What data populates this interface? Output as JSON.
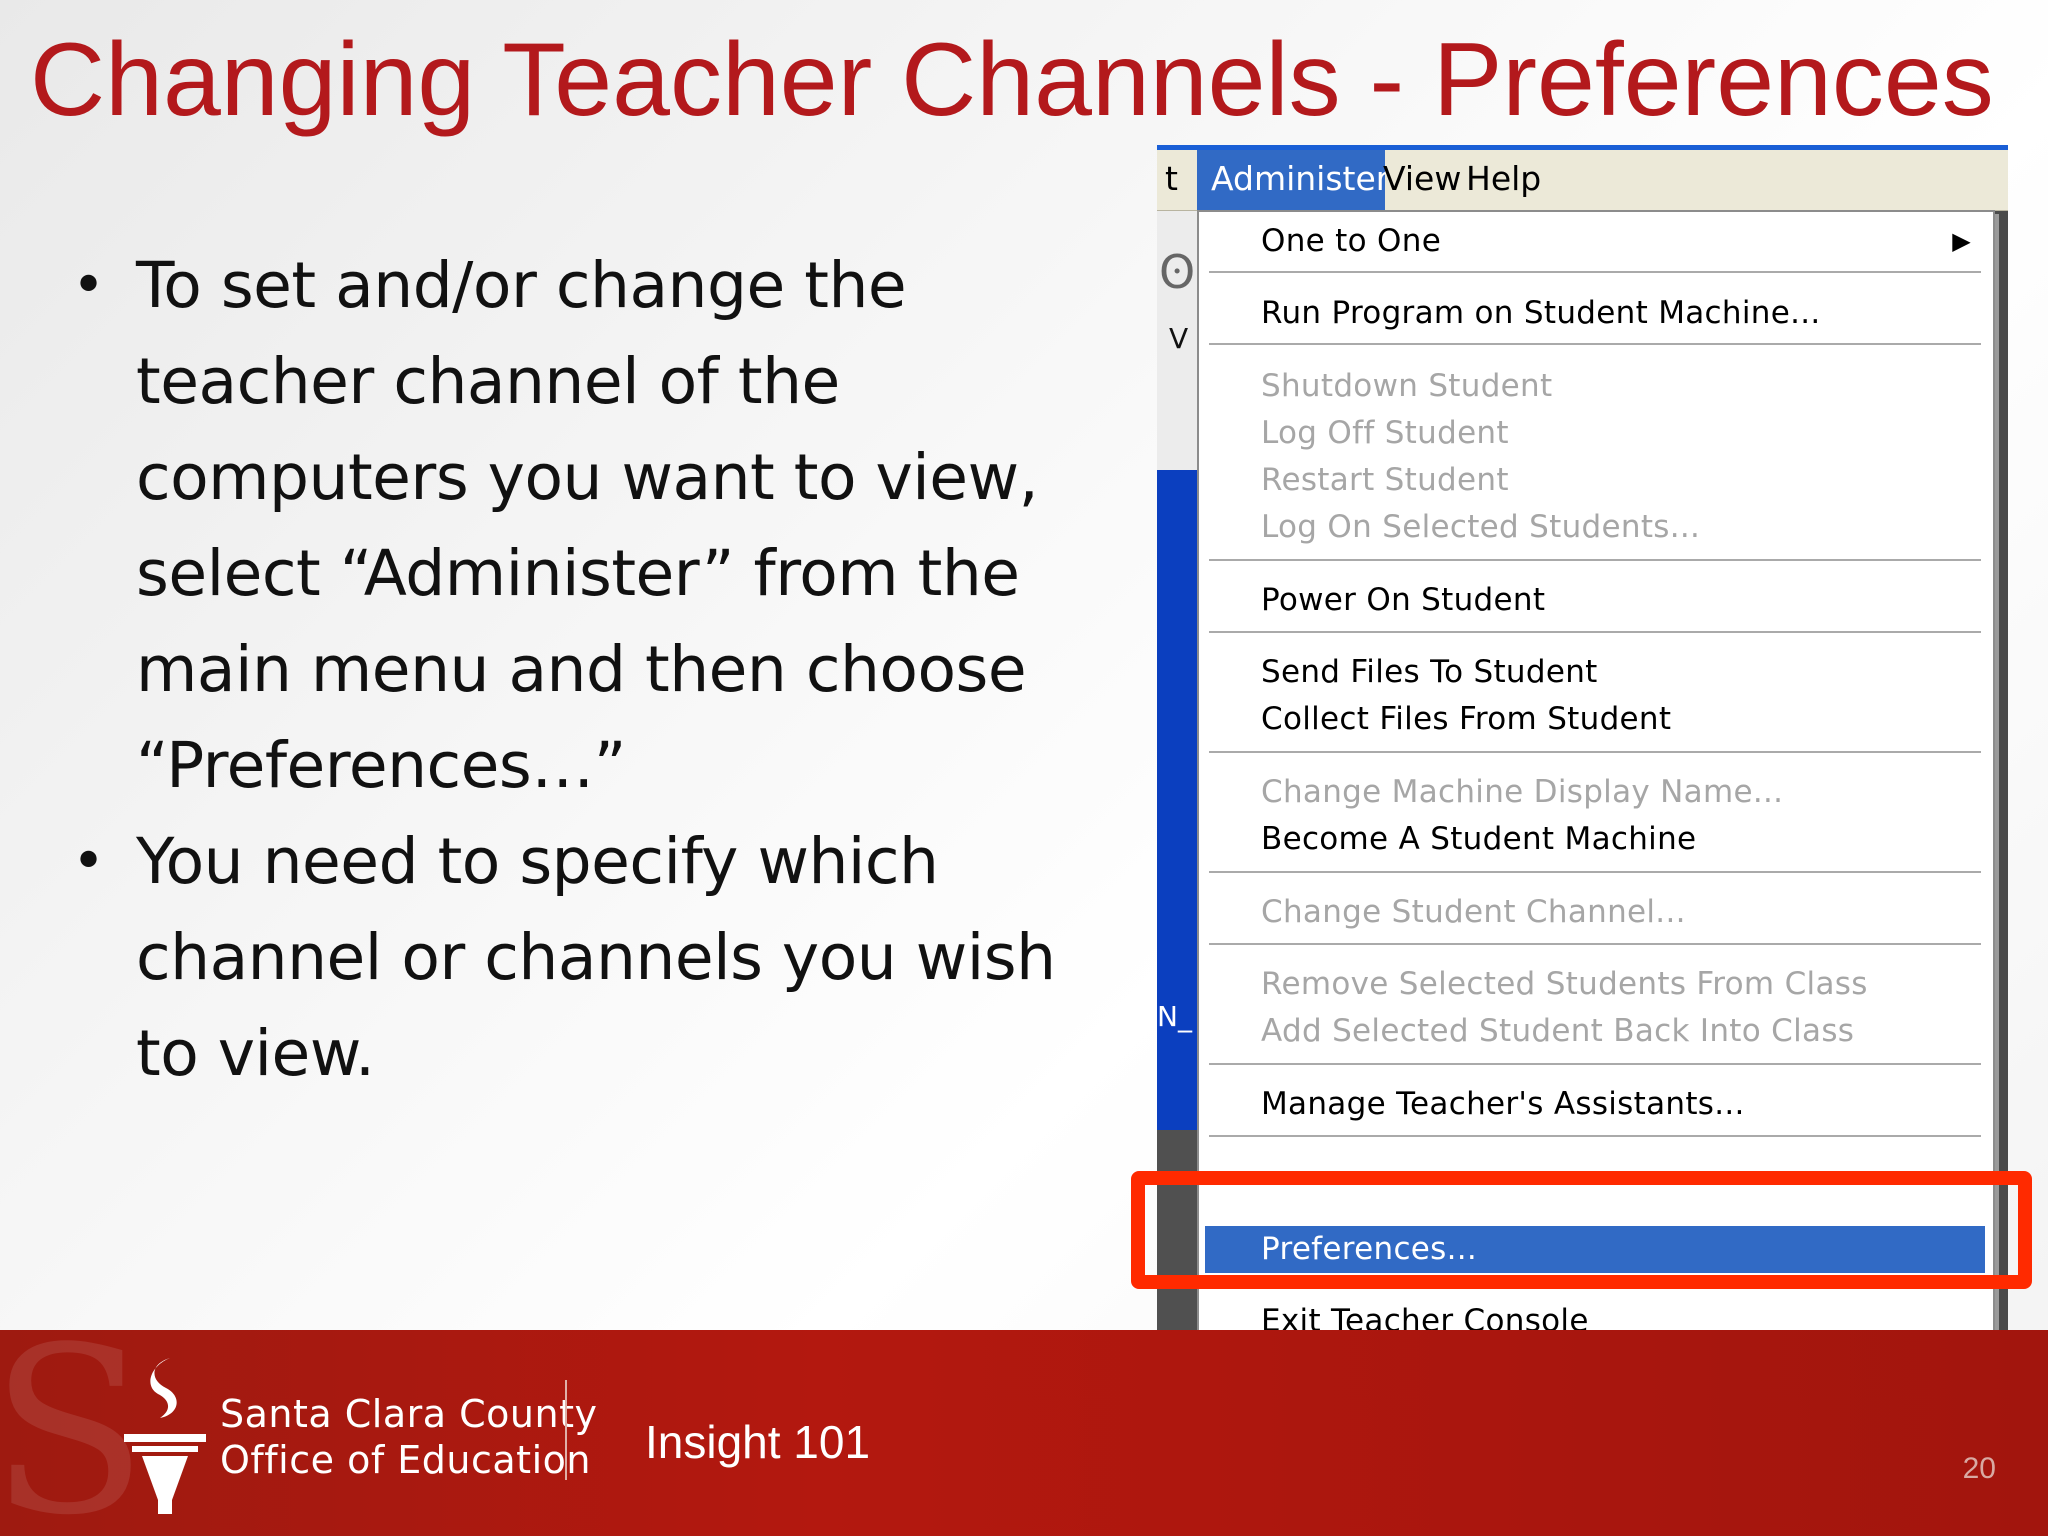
{
  "slide": {
    "title": "Changing Teacher Channels - Preferences",
    "bullets": [
      {
        "lines": [
          "To set and/or change the",
          "teacher channel of the",
          "computers you want to view,",
          "select “Administer” from the",
          "main menu and then choose",
          "“Preferences…”"
        ]
      },
      {
        "lines": [
          "You need to specify which",
          "channel or channels you wish",
          "to view."
        ]
      }
    ]
  },
  "screenshot": {
    "menubar": {
      "partial": "t",
      "items": [
        "Administer",
        "View",
        "Help"
      ],
      "active": "Administer"
    },
    "fragments": {
      "v": "V",
      "n": "N_"
    },
    "menu_items": {
      "one_to_one": "One to One",
      "run_program": "Run Program on Student Machine...",
      "shutdown": "Shutdown Student",
      "log_off": "Log Off Student",
      "restart": "Restart Student",
      "log_on": "Log On Selected Students...",
      "power_on": "Power On Student",
      "send_files": "Send Files To Student",
      "collect_files": "Collect Files From Student",
      "change_display_name": "Change Machine Display Name...",
      "become_student": "Become A Student Machine",
      "change_channel": "Change Student Channel...",
      "remove_students": "Remove Selected Students From Class",
      "add_back": "Add Selected Student Back Into Class",
      "manage_assistants": "Manage Teacher's Assistants...",
      "preferences": "Preferences...",
      "exit": "Exit Teacher Console"
    },
    "submenu_arrow": "▶"
  },
  "footer": {
    "org_line1": "Santa Clara County",
    "org_line2": "Office of Education",
    "course": "Insight 101",
    "page_number": "20"
  },
  "colors": {
    "title_red": "#b3191c",
    "footer_red": "#b3180f",
    "menu_highlight": "#316ac5",
    "callout_box": "#ff2a00"
  }
}
